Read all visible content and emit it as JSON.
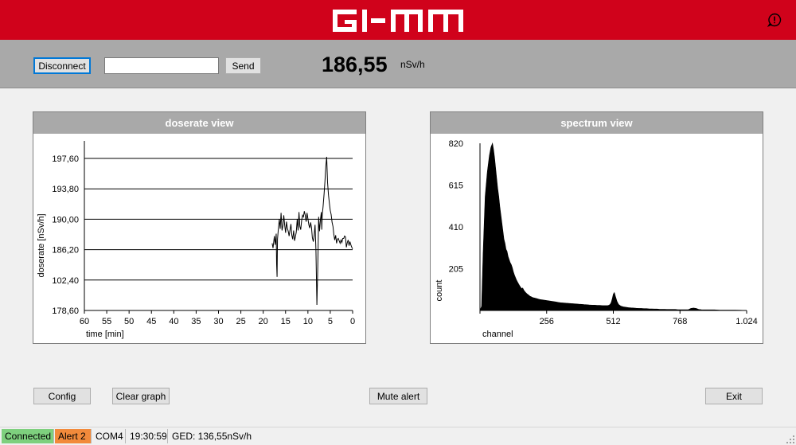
{
  "header": {
    "logo_text": "GI-MM"
  },
  "toolbar": {
    "disconnect_label": "Disconnect",
    "command_value": "",
    "send_label": "Send",
    "dose_value": "186,55",
    "dose_unit": "nSv/h"
  },
  "doserate_panel": {
    "title": "doserate view",
    "chart_data": {
      "type": "line",
      "xlabel": "time [min]",
      "ylabel": "doserate [nSv/h]",
      "x_ticks": [
        "60",
        "55",
        "50",
        "45",
        "40",
        "35",
        "30",
        "25",
        "20",
        "15",
        "10",
        "5",
        "0"
      ],
      "y_ticks": [
        "197,60",
        "193,80",
        "190,00",
        "186,20",
        "102,40",
        "178,60"
      ],
      "xlim": [
        60,
        0
      ],
      "ylim": [
        178.6,
        197.6
      ],
      "grid": "horizontal",
      "series": [
        {
          "x": [
            18.0,
            17.8,
            17.5,
            17.3,
            17.1,
            17.0,
            16.9,
            16.8,
            16.6,
            16.4,
            16.2,
            16.0,
            15.8,
            15.6,
            15.4,
            15.2,
            15.0,
            14.8,
            14.6,
            14.4,
            14.2,
            14.0,
            13.8,
            13.6,
            13.4,
            13.2,
            13.0,
            12.8,
            12.6,
            12.4,
            12.2,
            12.0,
            11.8,
            11.6,
            11.4,
            11.2,
            11.0,
            10.8,
            10.6,
            10.4,
            10.2,
            10.0,
            9.8,
            9.6,
            9.4,
            9.2,
            9.0,
            8.8,
            8.6,
            8.4,
            8.2,
            8.0,
            7.8,
            7.6,
            7.4,
            7.2,
            7.0,
            6.9,
            6.8,
            6.6,
            6.4,
            6.2,
            6.0,
            5.8,
            5.6,
            5.4,
            5.2,
            5.0,
            4.8,
            4.6,
            4.4,
            4.2,
            4.0,
            3.8,
            3.6,
            3.4,
            3.2,
            3.0,
            2.8,
            2.6,
            2.4,
            2.2,
            2.0,
            1.8,
            1.6,
            1.4,
            1.2,
            1.0,
            0.8,
            0.6,
            0.4,
            0.2,
            0.0
          ],
          "y": [
            187.0,
            186.4,
            187.9,
            186.8,
            188.2,
            184.4,
            182.8,
            187.5,
            188.9,
            190.0,
            188.8,
            190.8,
            188.6,
            189.2,
            190.5,
            189.3,
            188.3,
            189.7,
            188.9,
            188.5,
            187.9,
            188.7,
            189.4,
            188.0,
            187.5,
            188.6,
            187.3,
            187.8,
            188.4,
            190.0,
            188.6,
            190.9,
            189.1,
            188.7,
            189.9,
            190.5,
            190.3,
            191.0,
            190.5,
            189.7,
            190.8,
            190.1,
            189.3,
            188.9,
            189.6,
            189.0,
            187.7,
            187.2,
            188.0,
            189.3,
            186.2,
            179.3,
            184.0,
            190.3,
            188.5,
            190.0,
            190.9,
            188.7,
            190.5,
            191.6,
            193.1,
            194.7,
            196.6,
            197.8,
            194.6,
            193.0,
            192.0,
            191.1,
            190.6,
            189.6,
            189.1,
            188.1,
            187.4,
            188.0,
            187.0,
            187.5,
            187.6,
            187.3,
            187.0,
            187.4,
            187.1,
            187.6,
            187.6,
            187.9,
            187.8,
            186.5,
            187.1,
            187.4,
            186.7,
            187.2,
            186.8,
            186.5,
            186.3
          ]
        }
      ]
    }
  },
  "spectrum_panel": {
    "title": "spectrum view",
    "chart_data": {
      "type": "area",
      "xlabel": "channel",
      "ylabel": "count",
      "x_ticks": [
        "256",
        "512",
        "768",
        "1.024"
      ],
      "y_ticks": [
        "820",
        "615",
        "410",
        "205"
      ],
      "xlim": [
        0,
        1024
      ],
      "ylim": [
        0,
        820
      ],
      "series": [
        {
          "x": [
            0,
            6,
            12,
            20,
            28,
            36,
            42,
            48,
            52,
            56,
            60,
            64,
            68,
            72,
            76,
            80,
            84,
            88,
            92,
            96,
            100,
            104,
            108,
            112,
            116,
            120,
            124,
            128,
            132,
            136,
            140,
            144,
            148,
            152,
            156,
            160,
            164,
            168,
            172,
            176,
            180,
            184,
            188,
            192,
            196,
            200,
            206,
            212,
            218,
            224,
            230,
            240,
            250,
            260,
            270,
            280,
            290,
            300,
            310,
            320,
            330,
            340,
            350,
            360,
            370,
            380,
            390,
            400,
            410,
            420,
            430,
            440,
            450,
            460,
            470,
            480,
            490,
            496,
            500,
            504,
            508,
            512,
            516,
            520,
            526,
            532,
            540,
            550,
            560,
            570,
            580,
            590,
            600,
            610,
            620,
            630,
            640,
            650,
            660,
            670,
            680,
            690,
            700,
            710,
            720,
            730,
            740,
            750,
            760,
            770,
            780,
            790,
            800,
            810,
            820,
            830,
            840,
            850,
            860,
            870,
            880,
            890,
            900,
            920,
            940,
            960,
            980,
            1000,
            1024
          ],
          "y": [
            0,
            20,
            280,
            560,
            680,
            760,
            800,
            820,
            790,
            750,
            700,
            650,
            600,
            560,
            510,
            470,
            430,
            390,
            350,
            330,
            300,
            290,
            265,
            250,
            235,
            225,
            210,
            190,
            175,
            162,
            150,
            140,
            131,
            122,
            114,
            107,
            110,
            100,
            93,
            87,
            82,
            78,
            74,
            70,
            68,
            65,
            62,
            60,
            58,
            56,
            54,
            52,
            50,
            48,
            46,
            44,
            42,
            40,
            38,
            37,
            36,
            35,
            34,
            33,
            32,
            31,
            30,
            29,
            28,
            27,
            26,
            26,
            25,
            25,
            24,
            24,
            24,
            26,
            30,
            40,
            58,
            80,
            88,
            70,
            45,
            30,
            22,
            18,
            16,
            14,
            13,
            12,
            11,
            10,
            10,
            9,
            9,
            8,
            8,
            7,
            7,
            6,
            6,
            6,
            5,
            5,
            5,
            5,
            4,
            4,
            4,
            4,
            4,
            10,
            12,
            10,
            5,
            4,
            3,
            3,
            3,
            3,
            3,
            2,
            2,
            2,
            2,
            1,
            0
          ]
        }
      ]
    }
  },
  "buttons": {
    "config_label": "Config",
    "clear_graph_label": "Clear graph",
    "mute_alert_label": "Mute alert",
    "exit_label": "Exit"
  },
  "statusbar": {
    "connected": "Connected",
    "alert": "Alert 2",
    "port": "COM4",
    "time": "19:30:59",
    "ged": "GED: 136,55nSv/h"
  },
  "colors": {
    "brand_red": "#d0021b",
    "connected_green": "#7ed07e",
    "alert_orange": "#f28a3b"
  }
}
